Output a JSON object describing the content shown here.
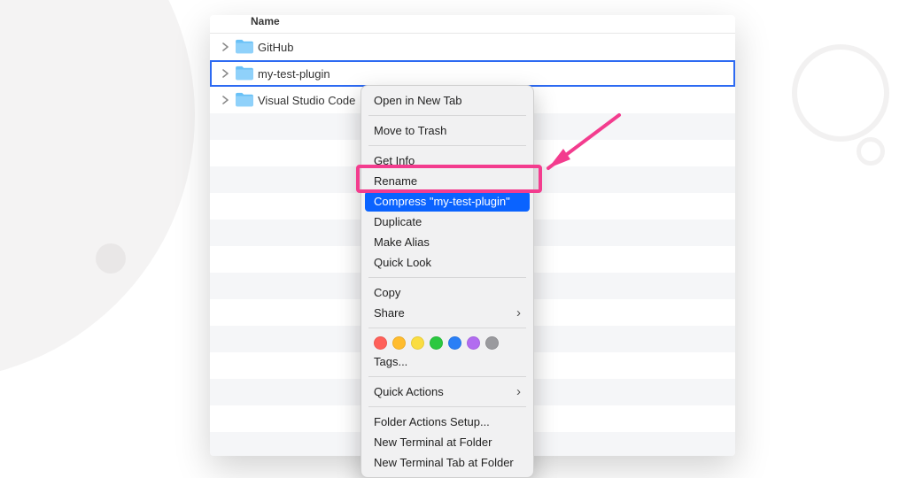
{
  "header": {
    "name_col": "Name"
  },
  "rows": [
    {
      "label": "GitHub"
    },
    {
      "label": "my-test-plugin"
    },
    {
      "label": "Visual Studio Code"
    }
  ],
  "context_menu": {
    "open_new_tab": "Open in New Tab",
    "move_to_trash": "Move to Trash",
    "get_info": "Get Info",
    "rename": "Rename",
    "compress": "Compress \"my-test-plugin\"",
    "duplicate": "Duplicate",
    "make_alias": "Make Alias",
    "quick_look": "Quick Look",
    "copy": "Copy",
    "share": "Share",
    "tags": "Tags...",
    "quick_actions": "Quick Actions",
    "folder_actions": "Folder Actions Setup...",
    "new_terminal": "New Terminal at Folder",
    "new_terminal_tab": "New Terminal Tab at Folder"
  },
  "tag_colors": [
    "#ff6059",
    "#ffbc2e",
    "#fadd41",
    "#2bc840",
    "#2a7ff6",
    "#b26cf0",
    "#9a9a9e"
  ],
  "annotation": {
    "color": "#f33c8e"
  }
}
